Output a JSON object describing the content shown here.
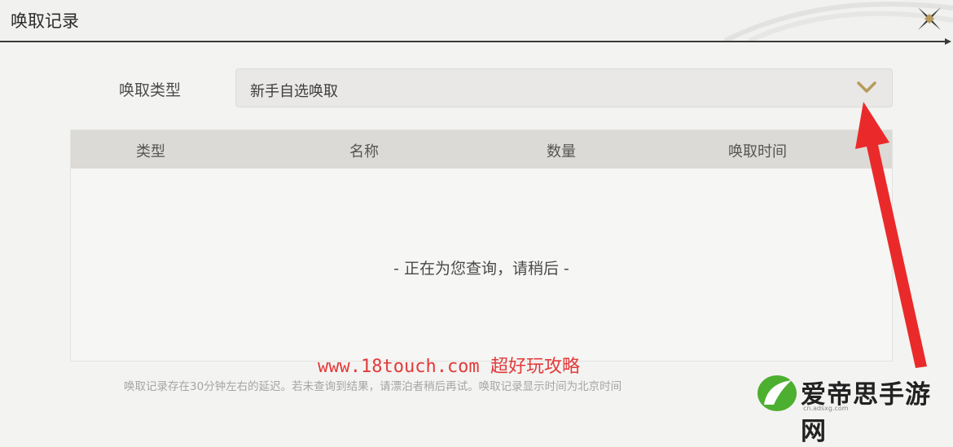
{
  "header": {
    "title": "唤取记录",
    "close_icon": "close-x-icon"
  },
  "filter": {
    "label": "唤取类型",
    "selected": "新手自选唤取",
    "chevron_icon": "chevron-down-icon",
    "accent_color": "#b89a5a"
  },
  "table": {
    "columns": [
      "类型",
      "名称",
      "数量",
      "唤取时间"
    ],
    "loading_text": "- 正在为您查询，请稍后 -"
  },
  "watermark": {
    "url": "www.18touch.com",
    "text": "超好玩攻略",
    "color": "#e23a3a"
  },
  "footer_note": "唤取记录存在30分钟左右的延迟。若未查询到结果，请漂泊者稍后再试。唤取记录显示时间为北京时间",
  "site_logo": {
    "name": "爱帝思手游网",
    "url": "cn.adsxg.com"
  }
}
